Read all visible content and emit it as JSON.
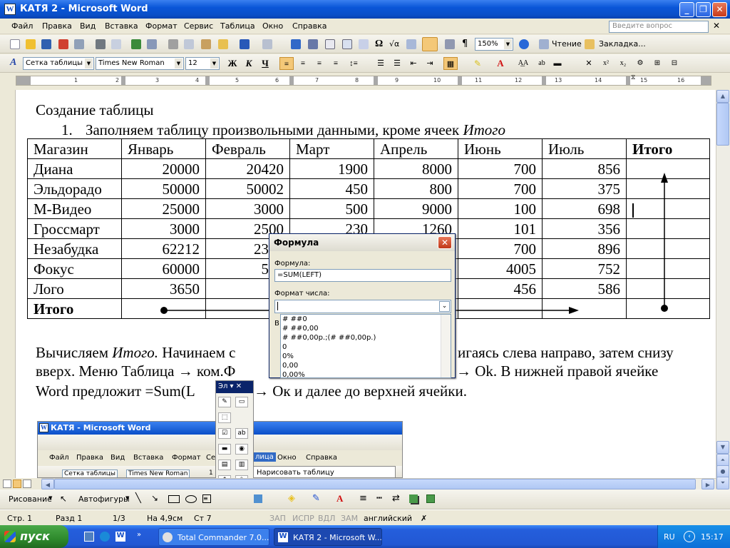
{
  "window": {
    "title": "КАТЯ 2 - Microsoft Word",
    "app_icon": "word-icon"
  },
  "menu": {
    "items": [
      "Файл",
      "Правка",
      "Вид",
      "Вставка",
      "Формат",
      "Сервис",
      "Таблица",
      "Окно",
      "Справка"
    ],
    "ask_placeholder": "Введите вопрос"
  },
  "toolbar_std": {
    "zoom": "150%",
    "read_label": "Чтение",
    "bookmark_label": "Закладка..."
  },
  "toolbar_fmt": {
    "style": "Сетка таблицы",
    "font": "Times New Roman",
    "size": "12",
    "bold": "Ж",
    "italic": "К",
    "underline": "Ч"
  },
  "ruler": {
    "numbers": [
      "1",
      "2",
      "3",
      "4",
      "5",
      "6",
      "7",
      "8",
      "9",
      "10",
      "11",
      "12",
      "13",
      "14",
      "15",
      "16"
    ]
  },
  "doc": {
    "heading": "Создание таблицы",
    "step1_num": "1.",
    "step1_text": "Заполняем таблицу произвольными данными, кроме ячеек ",
    "step1_italic": "Итого",
    "table": {
      "headers": [
        "Магазин",
        "Январь",
        "Февраль",
        "Март",
        "Апрель",
        "Июнь",
        "Июль",
        "Итого"
      ],
      "rows": [
        [
          "Диана",
          "20000",
          "20420",
          "1900",
          "8000",
          "700",
          "856",
          ""
        ],
        [
          "Эльдорадо",
          "50000",
          "50002",
          "450",
          "800",
          "700",
          "375",
          ""
        ],
        [
          "М-Видео",
          "25000",
          "3000",
          "500",
          "9000",
          "100",
          "698",
          ""
        ],
        [
          "Гроссмарт",
          "3000",
          "2500",
          "230",
          "1260",
          "101",
          "356",
          ""
        ],
        [
          "Незабудка",
          "62212",
          "2300",
          "",
          "",
          "700",
          "896",
          ""
        ],
        [
          "Фокус",
          "60000",
          "553",
          "",
          "",
          "4005",
          "752",
          ""
        ],
        [
          "Лого",
          "3650",
          "50",
          "",
          "",
          "456",
          "586",
          ""
        ]
      ],
      "total_label": "Итого"
    },
    "para_line1_a": "Вычисляем ",
    "para_line1_i": "Итого.",
    "para_line1_b": " Начинаем с",
    "para_line1_c": "игаясь слева направо, затем снизу",
    "para_line2_a": "вверх.  Меню Таблица → ком.Ф",
    "para_line2_b": "→ Ok. В нижней правой ячейке",
    "para_line3_a": "Word предложит =Sum(L",
    "para_line3_b": "→ Ок и далее до верхней ячейки."
  },
  "dialog": {
    "title": "Формула",
    "formula_label": "Формула:",
    "formula_value": "=SUM(LEFT)",
    "format_label": "Формат числа:",
    "format_value": "",
    "options": [
      "# ##0",
      "# ##0,00",
      "# ##0,00р.;(# ##0,00р.)",
      "0",
      "0%",
      "0,00",
      "0,00%"
    ],
    "partial_label": "В"
  },
  "palette": {
    "title": "Эл"
  },
  "inset": {
    "title": "КАТЯ - Microsoft Word",
    "menu": [
      "Файл",
      "Правка",
      "Вид",
      "Вставка",
      "Формат",
      "Се",
      "лица",
      "Окно",
      "Справка"
    ],
    "style": "Сетка таблицы",
    "font": "Times New Roman",
    "size": "1",
    "tooltip": "Нарисовать таблицу"
  },
  "drawing_tb": {
    "draw_label": "Рисование",
    "autoshapes_label": "Автофигуры"
  },
  "status": {
    "page": "Стр. 1",
    "section": "Разд 1",
    "pages": "1/3",
    "at": "На 4,9см",
    "line": "Ст 7",
    "rec": "ЗАП",
    "trk": "ИСПР",
    "ext": "ВДЛ",
    "ovr": "ЗАМ",
    "lang": "английский"
  },
  "taskbar": {
    "start": "пуск",
    "tasks": [
      "Total Commander 7.0...",
      "КАТЯ 2 - Microsoft W..."
    ],
    "lang": "RU",
    "time": "15:17"
  }
}
